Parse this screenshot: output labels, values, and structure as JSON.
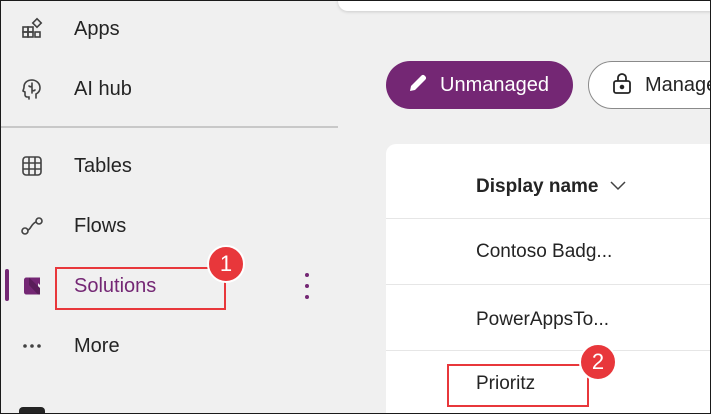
{
  "sidebar": {
    "items": [
      {
        "label": "Apps",
        "icon": "apps-icon"
      },
      {
        "label": "AI hub",
        "icon": "brain-icon"
      },
      {
        "label": "Tables",
        "icon": "table-grid-icon"
      },
      {
        "label": "Flows",
        "icon": "flow-icon"
      },
      {
        "label": "Solutions",
        "icon": "solutions-icon",
        "active": true
      },
      {
        "label": "More",
        "icon": "more-horizontal-icon"
      }
    ],
    "accent_color": "#742774"
  },
  "filters": {
    "unmanaged_label": "Unmanaged",
    "managed_label": "Manage"
  },
  "table": {
    "column_header": "Display name",
    "rows": [
      "Contoso Badg...",
      "PowerAppsTo...",
      "Prioritz"
    ]
  },
  "annotations": {
    "badge_1": "1",
    "badge_2": "2",
    "color": "#e8373b"
  }
}
